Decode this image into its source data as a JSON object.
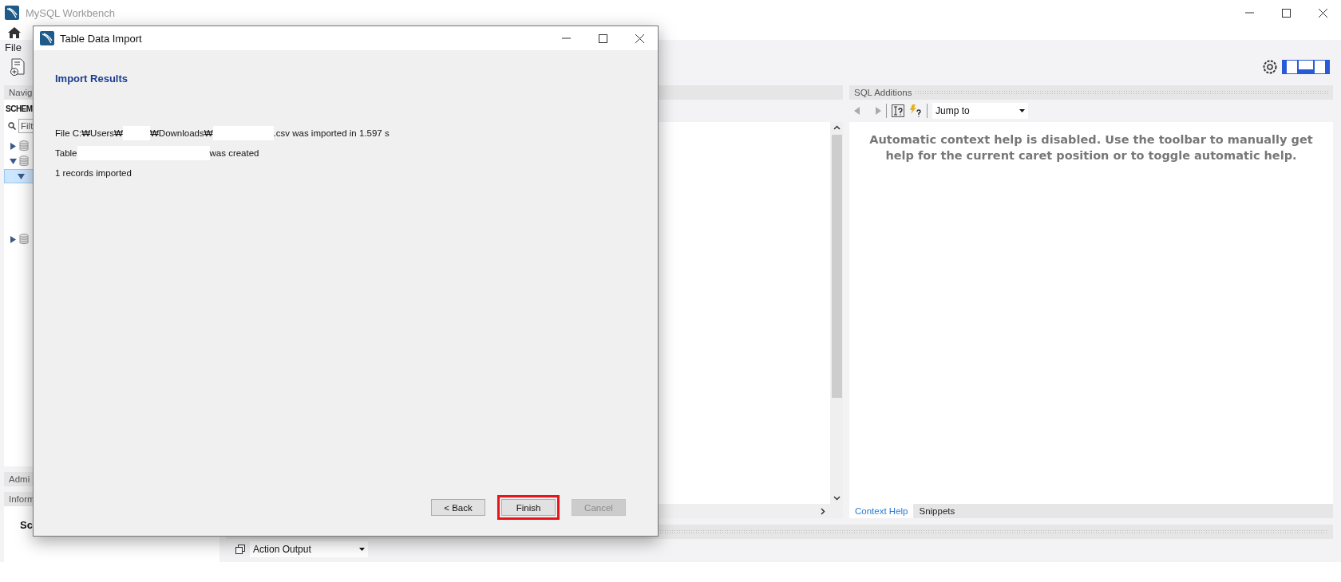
{
  "app": {
    "title": "MySQL Workbench"
  },
  "menu": [
    "File"
  ],
  "sidebar": {
    "header": "Navig",
    "section": "SCHEM",
    "filter_placeholder": "Filt",
    "tree": [
      {
        "expanded": false,
        "selected": false
      },
      {
        "expanded": true,
        "selected": false,
        "children": [
          {
            "expanded": true,
            "selected": true
          }
        ]
      },
      {
        "expanded": false,
        "selected": false
      }
    ],
    "bottom_tabs": [
      "Admi",
      "Inform"
    ],
    "info_title": "Sc"
  },
  "sql_additions": {
    "title": "SQL Additions",
    "jump_to": "Jump to",
    "help": "Automatic context help is disabled. Use the toolbar to manually get help for the current caret position or to toggle automatic help.",
    "tabs": [
      {
        "label": "Context Help",
        "selected": true
      },
      {
        "label": "Snippets",
        "selected": false
      }
    ]
  },
  "output": {
    "selector": "Action Output"
  },
  "dialog": {
    "title": "Table Data Import",
    "heading": "Import Results",
    "lines": [
      [
        {
          "kind": "text",
          "text": "File C:₩Users₩"
        },
        {
          "kind": "redacted_short"
        },
        {
          "kind": "text",
          "text": "₩Downloads₩"
        },
        {
          "kind": "redacted_medium"
        },
        {
          "kind": "text",
          "text": ".csv was imported in 1.597 s"
        }
      ],
      [
        {
          "kind": "text",
          "text": "Table"
        },
        {
          "kind": "redacted_long"
        },
        {
          "kind": "text",
          "text": "was created"
        }
      ],
      [
        {
          "kind": "text",
          "text": "1 records imported"
        }
      ]
    ],
    "buttons": [
      {
        "label": "< Back",
        "disabled": false,
        "highlighted": false
      },
      {
        "label": "Finish",
        "disabled": false,
        "highlighted": true
      },
      {
        "label": "Cancel",
        "disabled": true,
        "highlighted": false
      }
    ]
  }
}
